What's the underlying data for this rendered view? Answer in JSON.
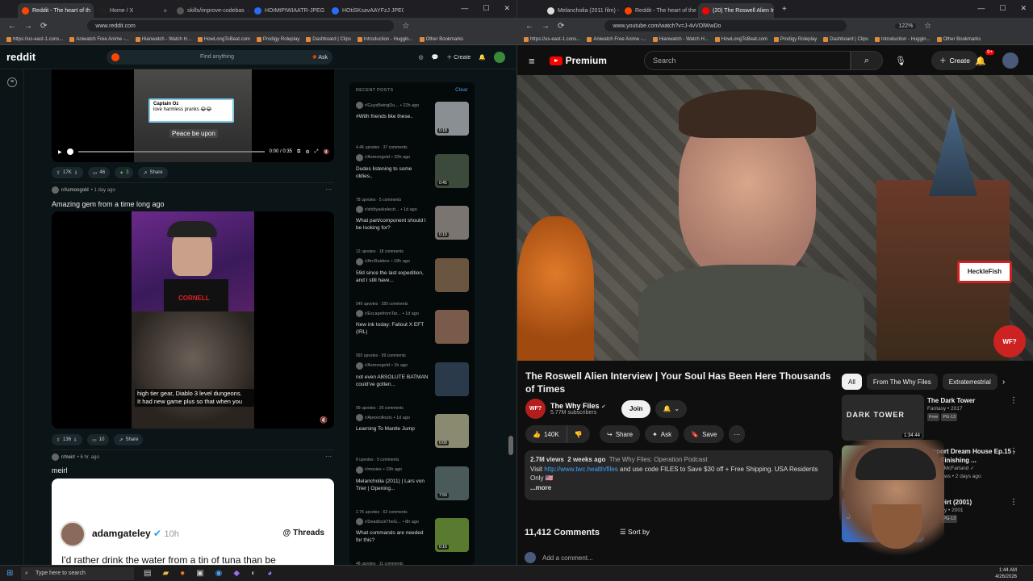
{
  "left": {
    "tabs": [
      {
        "title": "Reddit - The heart of th",
        "color": "#ff4500",
        "active": true
      },
      {
        "title": "Home / X",
        "color": "#222222",
        "active": false
      },
      {
        "title": "skills/improve-codebas",
        "color": "#555555",
        "active": false
      },
      {
        "title": "HOtMtPIWIAATR-JPEG",
        "color": "#2a6df4",
        "active": false
      },
      {
        "title": "HOtiSKsavAAYFzJ JPEG",
        "color": "#2a6df4",
        "active": false
      }
    ],
    "url": "www.reddit.com",
    "bookmarks": [
      "https://us-east-1.cons...",
      "Aniwatch Free Anime -...",
      "Hianwatch - Watch H...",
      "HowLongToBeat.com",
      "Prodigy Roleplay",
      "Dashboard | Clips",
      "Introduction - Huggin...",
      "Other Bookmarks"
    ],
    "reddit": {
      "logo": "reddit",
      "search_placeholder": "Find anything",
      "ask": "Ask",
      "create": "Create",
      "post1": {
        "caption_user": "Captain Oz",
        "caption_text": "love harmless pranks 😂😂",
        "subtitle": "Peace be upon",
        "time": "0:00 / 0:35",
        "upvotes": "17K",
        "comments": "46",
        "awards": "3",
        "share": "Share"
      },
      "post2": {
        "subreddit": "r/Asmongold",
        "age": "• 1 day ago",
        "title": "Amazing gem from a time long ago",
        "cam_text": "CORNELL",
        "subtitle_line1": "high tier gear, Diablo 3 level dungeons.",
        "subtitle_line2": "It had new game plus so that when you",
        "upvotes": "136",
        "comments": "10",
        "share": "Share"
      },
      "post3": {
        "subreddit": "r/meirl",
        "age": "• 6 hr. ago",
        "title": "meirl",
        "author": "adamgateley",
        "author_time": "10h",
        "threads": "Threads",
        "body": "I'd rather drink the water from a tin of tuna than be"
      },
      "recent": {
        "header": "RECENT POSTS",
        "clear": "Clear",
        "items": [
          {
            "sub": "r/GuysBeingDu...",
            "age": "• 22h ago",
            "title": "#With friends like these..",
            "stats": "4.4K upvotes · 37 comments",
            "dur": "0:18",
            "color": "#8a8f94"
          },
          {
            "sub": "r/Asmongold",
            "age": "• 20h ago",
            "title": "Dudes listening to some oldies..",
            "stats": "78 upvotes · 5 comments",
            "dur": "0:45",
            "color": "#3c4a3c"
          },
          {
            "sub": "r/shittyaskelectr...",
            "age": "• 1d ago",
            "title": "What part/component should I be looking for?",
            "stats": "12 upvotes · 18 comments",
            "dur": "0:19",
            "color": "#7a7570"
          },
          {
            "sub": "r/ArcRaiders",
            "age": "• 18h ago",
            "title": "59d since the last expedition, and I still have...",
            "stats": "549 upvotes · 350 comments",
            "dur": "",
            "color": "#6a5540"
          },
          {
            "sub": "r/EscapefromTar...",
            "age": "• 1d ago",
            "title": "New ink today: Fallout X EFT (IRL)",
            "stats": "993 upvotes · 99 comments",
            "dur": "",
            "color": "#7a5a4a"
          },
          {
            "sub": "r/Asmongold",
            "age": "• 1h ago",
            "title": "not even ABSOLUTE BATMAN could've gotten...",
            "stats": "99 upvotes · 26 comments",
            "dur": "",
            "color": "#2a3a4a"
          },
          {
            "sub": "r/Apexrollouts",
            "age": "• 1d ago",
            "title": "Learning To Mantle Jump",
            "stats": "8 upvotes · 5 comments",
            "dur": "0:09",
            "color": "#8a8a70"
          },
          {
            "sub": "r/movies",
            "age": "• 19h ago",
            "title": "Melancholia (2011) | Lars von Trier | Opening...",
            "stats": "2.7K upvotes · 62 comments",
            "dur": "7:59",
            "color": "#4a5a5a"
          },
          {
            "sub": "r/DeadlockTheG...",
            "age": "• 8h ago",
            "title": "What commands are needed for this?",
            "stats": "48 upvotes · 11 comments",
            "dur": "0:16",
            "color": "#5a7a30"
          }
        ]
      }
    }
  },
  "right": {
    "tabs": [
      {
        "title": "Melancholia (2011 film) - Wikip",
        "color": "#dddddd",
        "active": false
      },
      {
        "title": "Reddit - The heart of the intern",
        "color": "#ff4500",
        "active": false
      },
      {
        "title": "(20) The Roswell Alien Inte",
        "color": "#ff0000",
        "active": true
      }
    ],
    "url": "www.youtube.com/watch?v=J-4vVOlWwDo",
    "zoom": "122%",
    "bookmarks": [
      "https://us-east-1.cons...",
      "Aniwatch Free Anime -...",
      "Hianwatch - Watch H...",
      "HowLongToBeat.com",
      "Prodigy Roleplay",
      "Dashboard | Clips",
      "Introduction - Huggin...",
      "Other Bookmarks"
    ],
    "youtube": {
      "logo": "Premium",
      "search_placeholder": "Search",
      "create": "Create",
      "notif_count": "9+",
      "video_sign": "HeckleFish",
      "video_title": "The Roswell Alien Interview | Your Soul Has Been Here Thousands of Times",
      "channel": "The Why Files",
      "channel_logo": "WF?",
      "subscribers": "5.77M subscribers",
      "join": "Join",
      "likes": "140K",
      "share": "Share",
      "ask": "Ask",
      "save": "Save",
      "views": "2.7M views",
      "age": "2 weeks ago",
      "podcast": "The Why Files: Operation Podcast",
      "desc_pre": "Visit ",
      "desc_link": "http://www.twc.health/files",
      "desc_post": " and use code FILES to Save $30 off + Free Shipping. USA Residents Only 🇺🇸",
      "more": "...more",
      "comments_count": "11,412 Comments",
      "sort": "Sort by",
      "add_comment": "Add a comment...",
      "chips": [
        "All",
        "From The Why Files",
        "Extraterrestrial"
      ],
      "recs": [
        {
          "title": "The Dark Tower",
          "channel": "Fantasy • 2017",
          "badges": [
            "Free",
            "PG-13"
          ],
          "dur": "1:34:44",
          "color": "#2a2a2a",
          "thumb_text": "DARK TOWER"
        },
        {
          "title": "Airport Dream House Ep.15 - The Finishing ...",
          "channel": "Justus McFarland ✓",
          "meta": "334 views • 2 days ago",
          "dur": "",
          "color": "#7a8a6a",
          "thumb_text": ""
        },
        {
          "title": "Joe Dirt (2001)",
          "channel": "Comedy • 2001",
          "badges": [
            "Free",
            "PG-13"
          ],
          "dur": "",
          "color": "#3a6ac0",
          "thumb_text": "JOE"
        }
      ]
    }
  },
  "taskbar": {
    "search_placeholder": "Type here to search",
    "time": "1:44 AM",
    "date": "4/26/2026"
  }
}
